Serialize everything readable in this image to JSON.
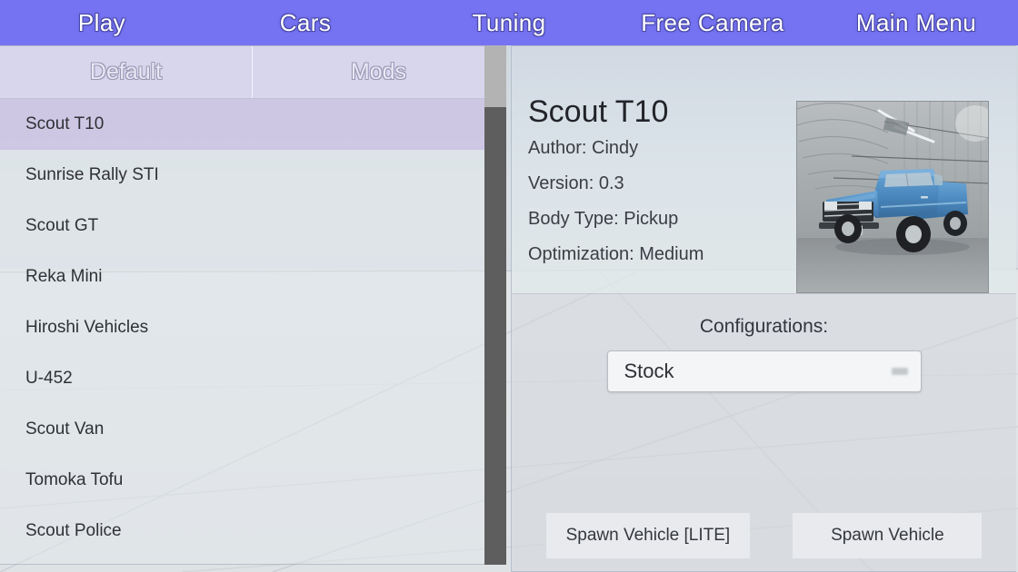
{
  "topnav": {
    "items": [
      {
        "label": "Play",
        "name": "nav-play"
      },
      {
        "label": "Cars",
        "name": "nav-cars"
      },
      {
        "label": "Tuning",
        "name": "nav-tuning"
      },
      {
        "label": "Free Camera",
        "name": "nav-free-camera"
      },
      {
        "label": "Main Menu",
        "name": "nav-main-menu"
      }
    ],
    "background_color": "#7573f2",
    "text_color": "#ffffff"
  },
  "left_panel": {
    "tabs": [
      {
        "label": "Default",
        "active": true
      },
      {
        "label": "Mods",
        "active": false
      }
    ],
    "vehicles": [
      {
        "label": "Scout T10",
        "selected": true
      },
      {
        "label": "Sunrise Rally STI",
        "selected": false
      },
      {
        "label": "Scout GT",
        "selected": false
      },
      {
        "label": "Reka Mini",
        "selected": false
      },
      {
        "label": "Hiroshi Vehicles",
        "selected": false
      },
      {
        "label": "U-452",
        "selected": false
      },
      {
        "label": "Scout Van",
        "selected": false
      },
      {
        "label": "Tomoka Tofu",
        "selected": false
      },
      {
        "label": "Scout Police",
        "selected": false
      }
    ],
    "selected_highlight_color": "#cbc1e2"
  },
  "detail_panel": {
    "title": "Scout T10",
    "meta": [
      "Author: Cindy",
      "Version: 0.3",
      "Body Type: Pickup",
      "Optimization: Medium"
    ],
    "thumbnail": {
      "name": "vehicle-preview-thumbnail",
      "description": "blue pickup truck inside grey metal hangar",
      "vehicle_color": "#4f8fc4",
      "scene_color": "#9aa0a3"
    },
    "configurations": {
      "label": "Configurations:",
      "selected": "Stock",
      "options": [
        "Stock"
      ]
    },
    "buttons": [
      {
        "label": "Spawn Vehicle [LITE]",
        "name": "spawn-vehicle-lite-button"
      },
      {
        "label": "Spawn Vehicle",
        "name": "spawn-vehicle-button"
      }
    ]
  },
  "scrollbar": {
    "track_color": "#b3b3b3",
    "thumb_color": "#5e5e5e"
  }
}
